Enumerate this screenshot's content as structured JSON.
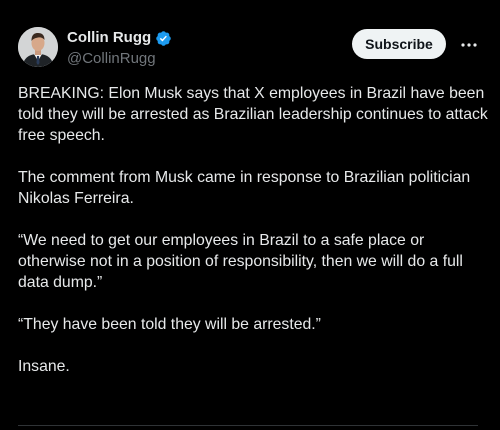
{
  "author": {
    "display_name": "Collin Rugg",
    "handle": "@CollinRugg",
    "verified": true
  },
  "actions": {
    "subscribe_label": "Subscribe",
    "more_icon": "more-horizontal-icon"
  },
  "tweet": {
    "paragraphs": [
      "BREAKING: Elon Musk says that X employees in Brazil have been told they will be arrested as Brazilian leadership continues to attack free speech.",
      "The comment from Musk came in response to Brazilian politician Nikolas Ferreira.",
      "“We need to get our employees in Brazil to a safe place or otherwise not in a position of responsibility, then we will do a full data dump.”",
      "“They have been told they will be arrested.”",
      "Insane."
    ]
  },
  "colors": {
    "background": "#000000",
    "text_primary": "#e7e9ea",
    "text_secondary": "#71767b",
    "verified_blue": "#1d9bf0",
    "button_bg": "#eff3f4",
    "button_text": "#0f1419"
  }
}
